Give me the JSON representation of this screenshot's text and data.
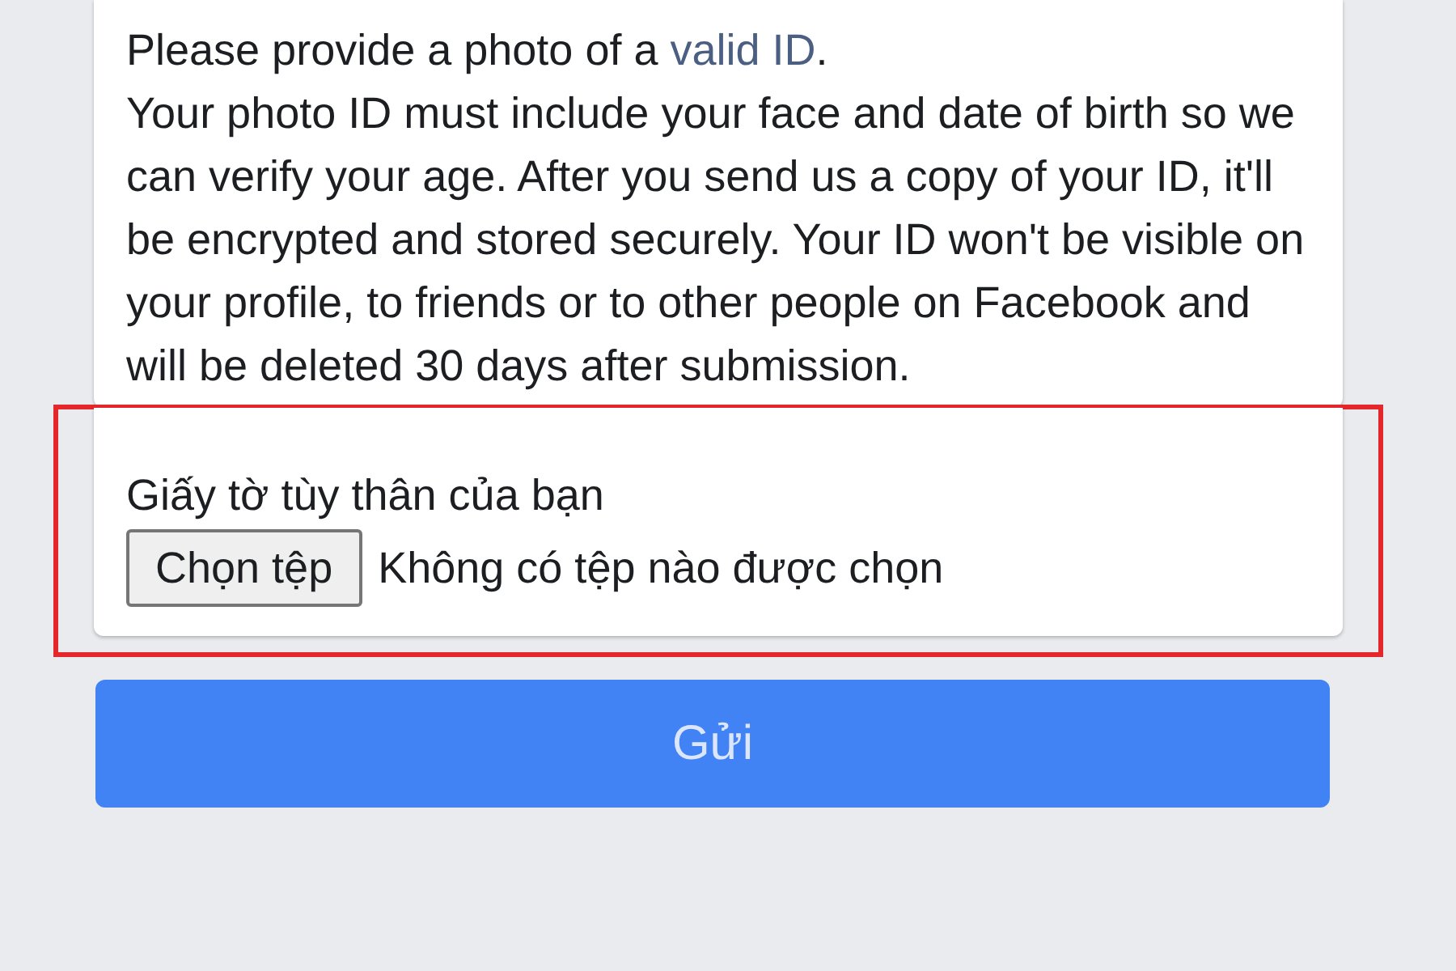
{
  "intro": {
    "text": "Please provide a photo of a",
    "link": "valid ID",
    "end": "."
  },
  "body": "Your photo ID must include your face and date of birth so we can verify your age. After you send us a copy of your ID, it'll be encrypted and stored securely. Your ID won't be visible on your profile, to friends or to other people on Facebook and will be deleted 30 days after submission.",
  "upload": {
    "label": "Giấy tờ tùy thân của bạn",
    "button": "Chọn tệp",
    "status": "Không có tệp nào được chọn",
    "highlighted": true
  },
  "submit": {
    "label": "Gửi",
    "disabled": true
  }
}
